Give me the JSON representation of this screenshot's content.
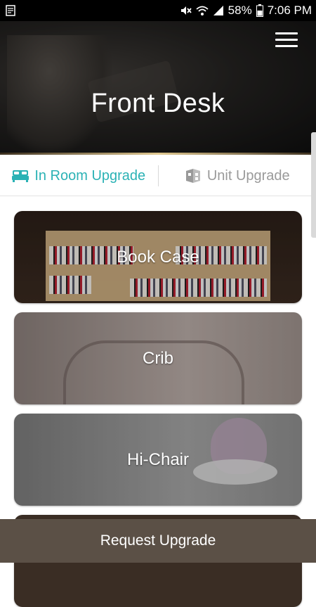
{
  "status_bar": {
    "battery": "58%",
    "time": "7:06 PM"
  },
  "header": {
    "title": "Front Desk"
  },
  "tabs": [
    {
      "label": "In Room Upgrade",
      "icon": "bed-icon",
      "active": true
    },
    {
      "label": "Unit Upgrade",
      "icon": "building-icon",
      "active": false
    }
  ],
  "cards": [
    {
      "label": "Book Case"
    },
    {
      "label": "Crib"
    },
    {
      "label": "Hi-Chair"
    }
  ],
  "footer": {
    "button_label": "Request Upgrade"
  },
  "colors": {
    "accent": "#2bb2b5",
    "footer_bg": "#5b5046",
    "inactive_tab": "#9a9a9a"
  }
}
